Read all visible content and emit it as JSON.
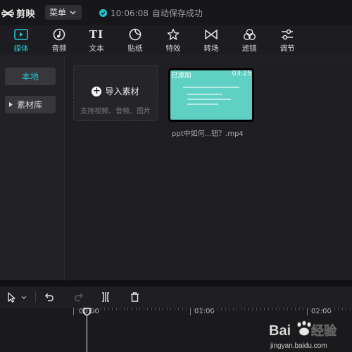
{
  "app": {
    "name": "剪映"
  },
  "titlebar": {
    "menu_label": "菜单",
    "save_time": "10:06:08",
    "save_text": "自动保存成功",
    "accent": "#27c4cf"
  },
  "toolbar": {
    "items": [
      {
        "label": "媒体",
        "icon": "media-icon",
        "active": true
      },
      {
        "label": "音频",
        "icon": "audio-icon"
      },
      {
        "label": "文本",
        "icon": "text-icon",
        "glyph": "TI"
      },
      {
        "label": "贴纸",
        "icon": "sticker-icon"
      },
      {
        "label": "特效",
        "icon": "effects-icon"
      },
      {
        "label": "转场",
        "icon": "transition-icon"
      },
      {
        "label": "滤镜",
        "icon": "filter-icon"
      },
      {
        "label": "调节",
        "icon": "adjust-icon"
      }
    ]
  },
  "sidebar": {
    "items": [
      {
        "label": "本地",
        "active": true
      },
      {
        "label": "素材库"
      }
    ]
  },
  "media": {
    "import_label": "导入素材",
    "import_hint": "支持视频、音频、图片",
    "clip": {
      "badge": "已添加",
      "duration": "03:25",
      "name": "ppt中如何...钮？.mp4",
      "thumb_color": "#5fd0c4"
    }
  },
  "timeline": {
    "labels": [
      "00:00",
      "01:00",
      "02:00"
    ]
  },
  "watermark": {
    "brand": "Bai du 经验",
    "url": "jingyan.baidu.com"
  }
}
